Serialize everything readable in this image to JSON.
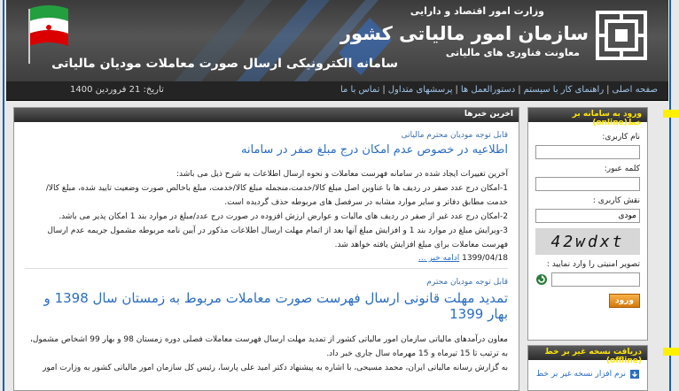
{
  "header": {
    "ministry": "وزارت امور اقتصاد و دارایی",
    "organization": "سازمان امور مالیاتی کشور",
    "deputy": "معاونت فناوری های مالیاتی",
    "system_title": "سامانه الکترونیکی ارسال صورت معاملات مودیان مالیاتی"
  },
  "nav": {
    "links": [
      "صفحه اصلی",
      "راهنمای کار با سیستم",
      "دستورالعمل ها",
      "پرسشهای متداول",
      "تماس با ما"
    ],
    "date_label": "تاریخ:",
    "date_value": "21 فروردین 1400"
  },
  "main": {
    "section_title": "اخرین خبرها",
    "news": [
      {
        "kicker": "قابل توجه مودیان محترم مالیاتی",
        "headline": "اطلاعیه در خصوص عدم امکان درج مبلغ صفر در سامانه",
        "paragraphs": [
          "آخرین تغییرات ایجاد شده در سامانه فهرست معاملات و نحوه ارسال اطلاعات به شرح ذیل می باشد:",
          "1-امکان درج عدد صفر در ردیف ها با عناوین اصل مبلغ کالا/خدمت،منجمله مبلغ کالا/خدمت، مبلغ باخالص صورت وضعیت تایید شده، مبلغ کالا/خدمت مطابق دفاتر و سایر موارد مشابه در سرفصل های مربوطه حذف گردیده است.",
          "2-امکان درج عدد غیر از صفر در ردیف های مالیات و عوارض ارزش افزوده در صورت درج عدد/مبلغ در موارد بند 1 امکان پذیر می باشد.",
          "3-ویرایش مبلغ در موارد بند 1 و افزایش مبلغ آنها بعد از اتمام مهلت ارسال اطلاعات مذکور در آیین نامه مربوطه مشمول جریمه عدم ارسال فهرست معاملات برای مبلغ افزایش یافته خواهد شد."
        ],
        "date": "1399/04/18",
        "more": "ادامه خبر ..."
      },
      {
        "kicker": "قابل توجه مودیان محترم",
        "headline": "تمدید مهلت قانونی ارسال فهرست صورت معاملات مربوط به زمستان سال 1398 و بهار 1399",
        "paragraphs": [
          "معاون درآمدهای مالیاتی سازمان امور مالیاتی کشور از تمدید مهلت ارسال فهرست معاملات فصلی دوره زمستان 98 و بهار 99 اشخاص مشمول، به ترتیب تا 15 تیرماه و 15 مهرماه سال جاری خبر داد.",
          "به گزارش رسانه مالیاتی ایران، محمد مسیحی، با اشاره به پیشنهاد دکتر امید علی پارسا، رئیس کل سازمان امور مالیاتی کشور به وزارت امور"
        ]
      }
    ]
  },
  "login": {
    "title": "ورود به سامانه بر خط(online)",
    "username_label": "نام کاربری:",
    "password_label": "کلمه عبور:",
    "role_label": "نقش کاربری :",
    "role_value": "مودی",
    "captcha_text": "42wdxt",
    "captcha_label": "تصویر امنیتی را وارد نمایید :",
    "submit_label": "ورود"
  },
  "offline": {
    "title": "دریافت نسخه غیر بر خط (offline)",
    "link": "نرم افزار نسخه غیر بر خط"
  },
  "colors": {
    "accent_yellow": "#ffef00",
    "link_blue": "#2a6dc4",
    "header_dark": "#3b3b3b"
  }
}
